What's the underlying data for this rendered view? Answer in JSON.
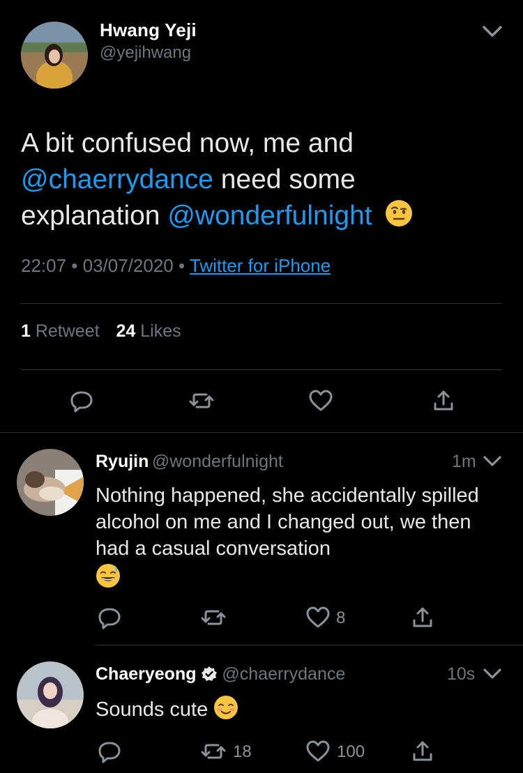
{
  "main_tweet": {
    "author": {
      "name": "Hwang Yeji",
      "handle": "@yejihwang"
    },
    "text_line1": "A bit confused now, me and",
    "mention1": "@chaerrydance",
    "text_line2": " need some",
    "text_line3": "explanation ",
    "mention2": "@wonderfulnight",
    "emoji": "raised-eyebrow-emoji",
    "time": "22:07",
    "sep1": " • ",
    "date": "03/07/2020",
    "sep2": " • ",
    "source": "Twitter for iPhone",
    "retweets_count": "1",
    "retweets_label": " Retweet",
    "likes_count": "24",
    "likes_label": " Likes"
  },
  "replies": [
    {
      "name": "Ryujin",
      "handle": "@wonderfulnight",
      "time": "1m",
      "text": "Nothing happened, she accidentally spilled alcohol on me and I changed out, we then had a casual conversation",
      "emoji": "sweat-smile-emoji",
      "retweet_count": "",
      "like_count": "8"
    },
    {
      "name": "Chaeryeong",
      "verified": true,
      "handle": "@chaerrydance",
      "time": "10s",
      "text": "Sounds cute ",
      "emoji": "smiling-blush-emoji",
      "retweet_count": "18",
      "like_count": "100"
    }
  ],
  "colors": {
    "background": "#000000",
    "link": "#1d9bf0",
    "muted": "#6e767d",
    "divider": "#2f3336"
  }
}
